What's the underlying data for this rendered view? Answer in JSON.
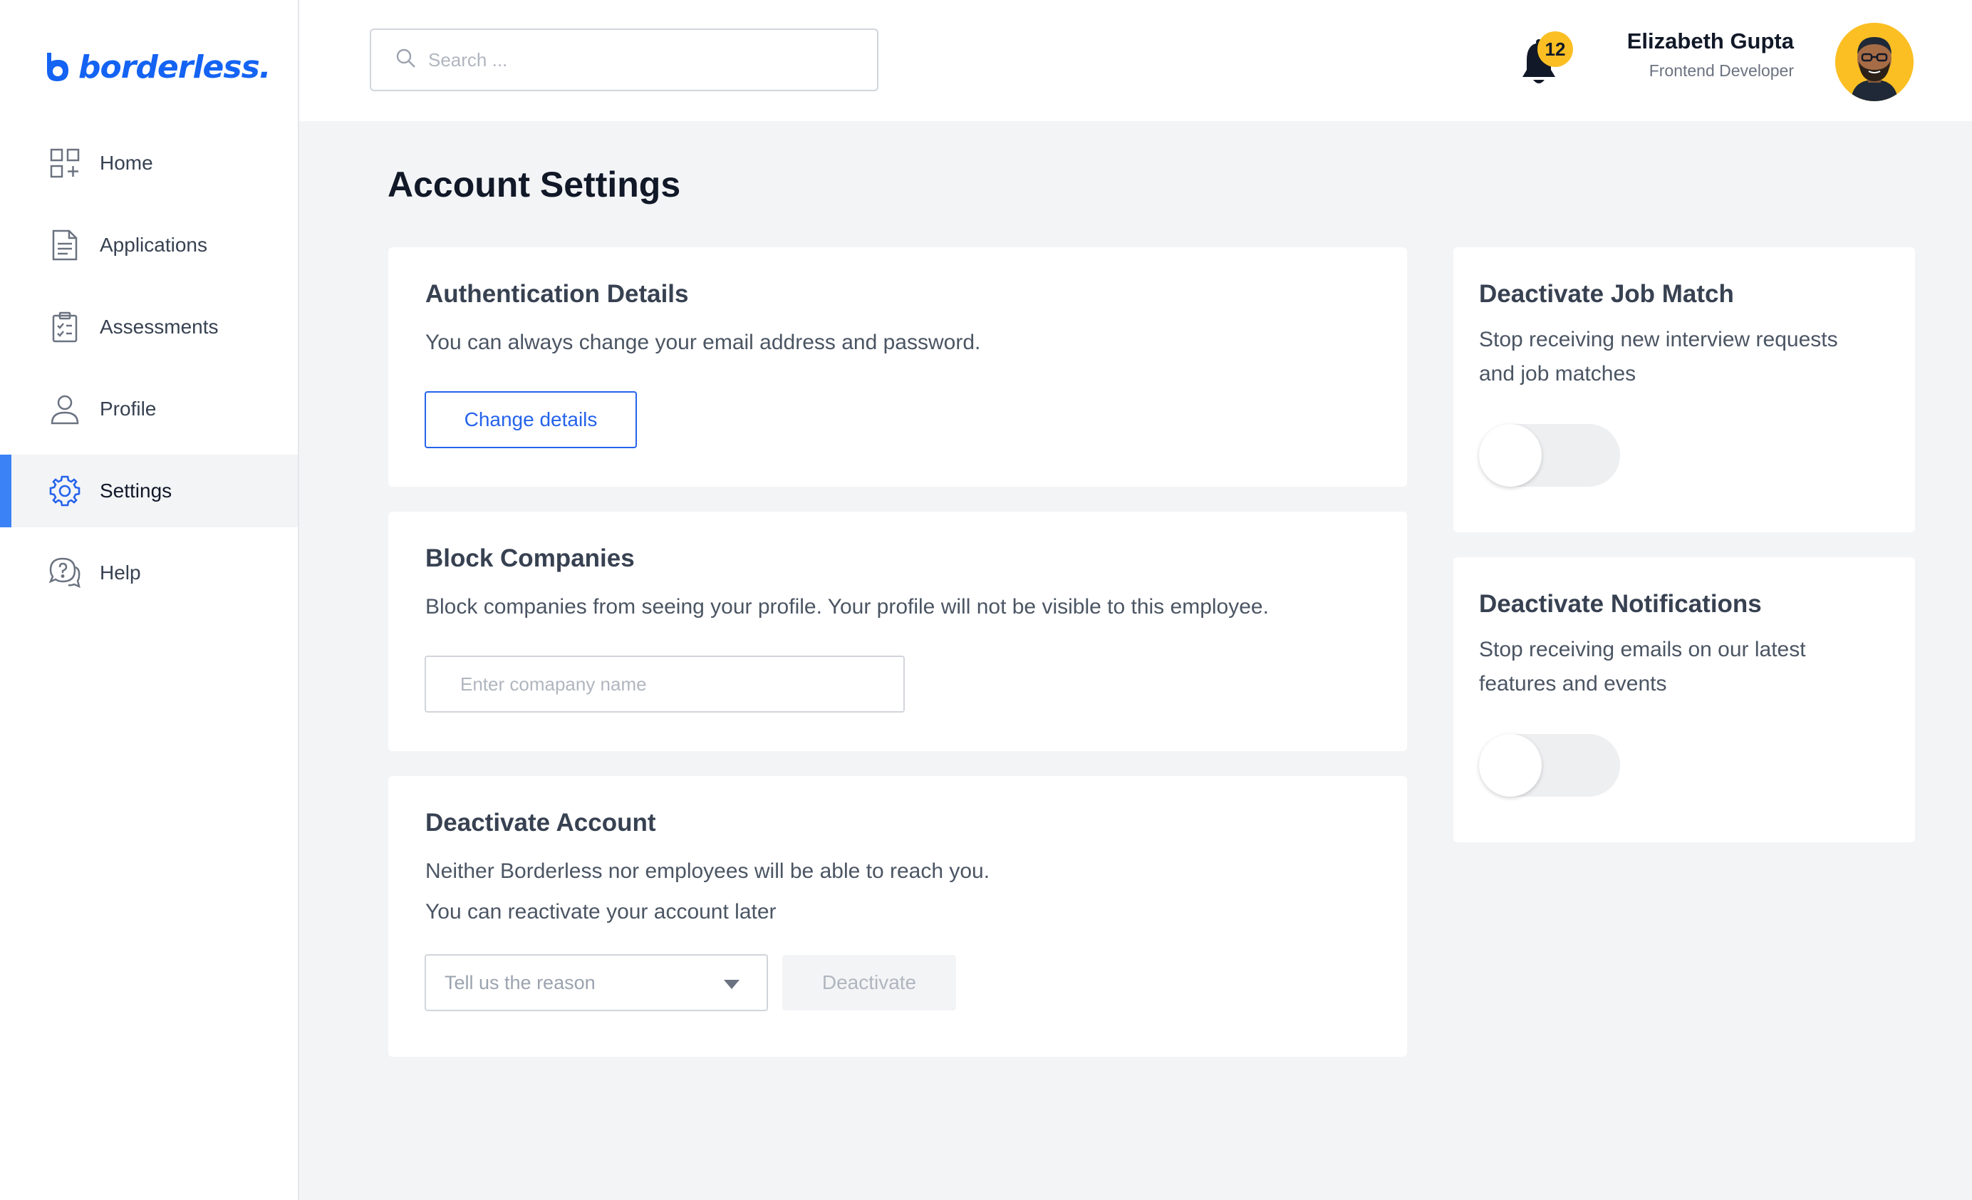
{
  "brand": {
    "name": "borderless.",
    "accent": "#1463f3",
    "active_indicator": "#3b82f6"
  },
  "sidebar": {
    "items": [
      {
        "label": "Home",
        "icon": "grid-icon",
        "active": false
      },
      {
        "label": "Applications",
        "icon": "document-icon",
        "active": false
      },
      {
        "label": "Assessments",
        "icon": "clipboard-check-icon",
        "active": false
      },
      {
        "label": "Profile",
        "icon": "user-icon",
        "active": false
      },
      {
        "label": "Settings",
        "icon": "gear-icon",
        "active": true
      },
      {
        "label": "Help",
        "icon": "chat-question-icon",
        "active": false
      }
    ]
  },
  "header": {
    "search_placeholder": "Search ...",
    "notification_count": "12",
    "user_name": "Elizabeth Gupta",
    "user_role": "Frontend Developer"
  },
  "page": {
    "title": "Account Settings"
  },
  "auth": {
    "title": "Authentication Details",
    "description": "You can always change your email address and password.",
    "button": "Change details"
  },
  "block": {
    "title": "Block Companies",
    "description": "Block companies from seeing your profile. Your profile will not be visible to this employee.",
    "input_placeholder": "Enter comapany name"
  },
  "deactivate_account": {
    "title": "Deactivate Account",
    "line1": "Neither Borderless nor employees will be able to reach you.",
    "line2": "You can reactivate your account later",
    "reason_placeholder": "Tell us the reason",
    "button": "Deactivate"
  },
  "job_match": {
    "title": "Deactivate Job Match",
    "line1": "Stop receiving new interview requests",
    "line2": "and job matches",
    "enabled": false
  },
  "notifications": {
    "title": "Deactivate Notifications",
    "line1": "Stop receiving emails on our latest",
    "line2": "features and events",
    "enabled": false
  }
}
